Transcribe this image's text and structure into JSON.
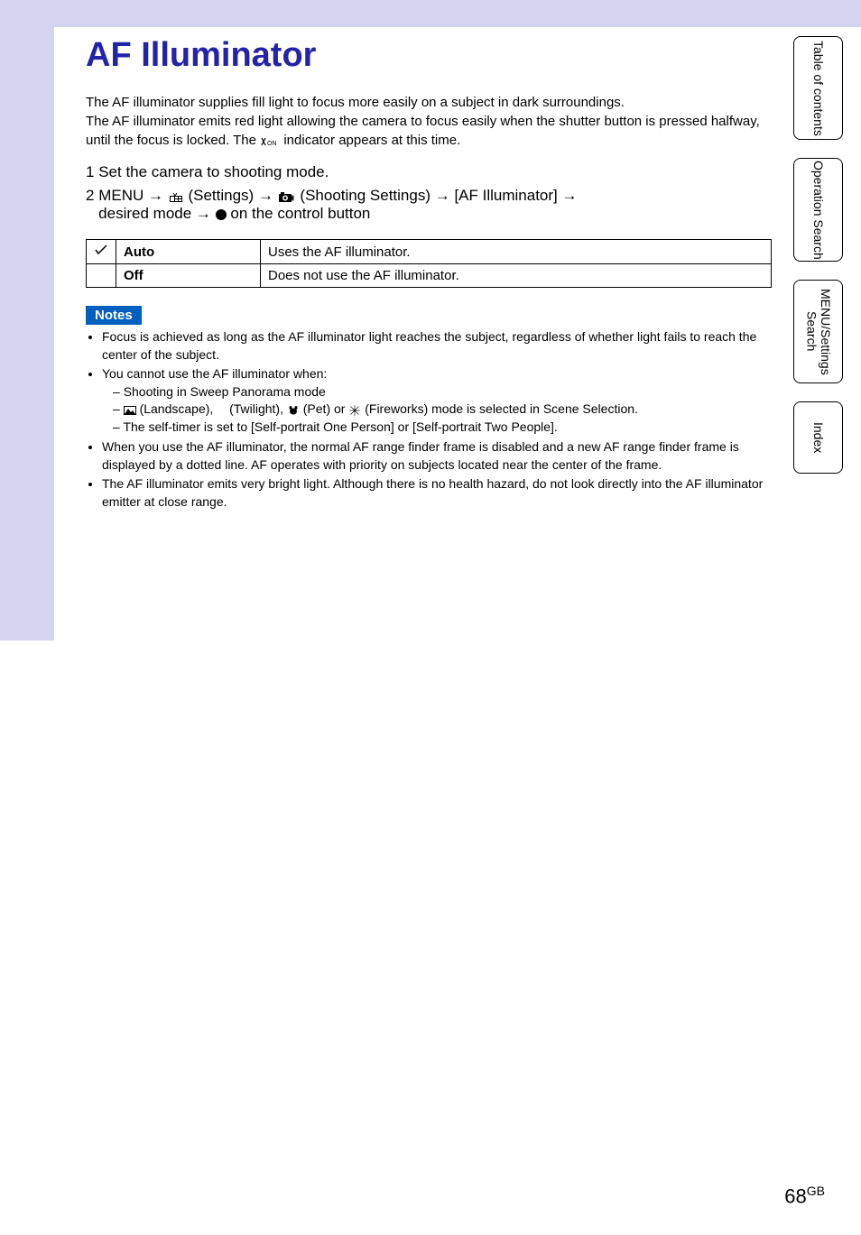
{
  "title": "AF Illuminator",
  "description_line1": "The AF illuminator supplies fill light to focus more easily on a subject in dark surroundings.",
  "description_line2": "The AF illuminator emits red light allowing the camera to focus easily when the shutter button is pressed halfway, until the focus is locked. The ",
  "description_line2_end": " indicator appears at this time.",
  "step1": {
    "num": "1",
    "text": "Set the camera to shooting mode."
  },
  "step2": {
    "num": "2",
    "line1_a": "MENU ",
    "line1_b": " (Settings) ",
    "line1_c": " (Shooting Settings) ",
    "line1_d": " [AF Illuminator] ",
    "line2_a": "desired mode ",
    "line2_b": " on the control button"
  },
  "arrow": "→",
  "table": {
    "rows": [
      {
        "check": "✓",
        "label": "Auto",
        "desc": "Uses the AF illuminator."
      },
      {
        "check": "",
        "label": "Off",
        "desc": "Does not use the AF illuminator."
      }
    ]
  },
  "notes_label": "Notes",
  "notes": [
    "Focus is achieved as long as the AF illuminator light reaches the subject, regardless of whether light fails to reach the center of the subject.",
    "You cannot use the AF illuminator when:"
  ],
  "note2_sub": [
    "Shooting in Sweep Panorama mode",
    " (Landscape),  (Twilight),  (Pet) or  (Fireworks) mode is selected in Scene Selection.",
    "The self-timer is set to [Self-portrait One Person] or [Self-portrait Two People]."
  ],
  "note2_sub_parts": {
    "landscape": " (Landscape), ",
    "twilight": " (Twilight), ",
    "pet": " (Pet) or ",
    "fireworks": " (Fireworks) mode is selected in Scene Selection."
  },
  "notes_after": [
    "When you use the AF illuminator, the normal AF range finder frame is disabled and a new AF range finder frame is displayed by a dotted line. AF operates with priority on subjects located near the center of the frame.",
    "The AF illuminator emits very bright light. Although there is no health hazard, do not look directly into the AF illuminator emitter at close range."
  ],
  "tabs": [
    "Table of contents",
    "Operation Search",
    "MENU/Settings Search",
    "Index"
  ],
  "page_num": "68",
  "page_gb": "GB",
  "icons": {
    "eon": "ꓘON",
    "settings": "settings-icon",
    "camera_settings": "camera-settings-icon",
    "landscape": "landscape-icon",
    "twilight": "twilight-icon",
    "pet": "pet-icon",
    "fireworks": "fireworks-icon"
  }
}
